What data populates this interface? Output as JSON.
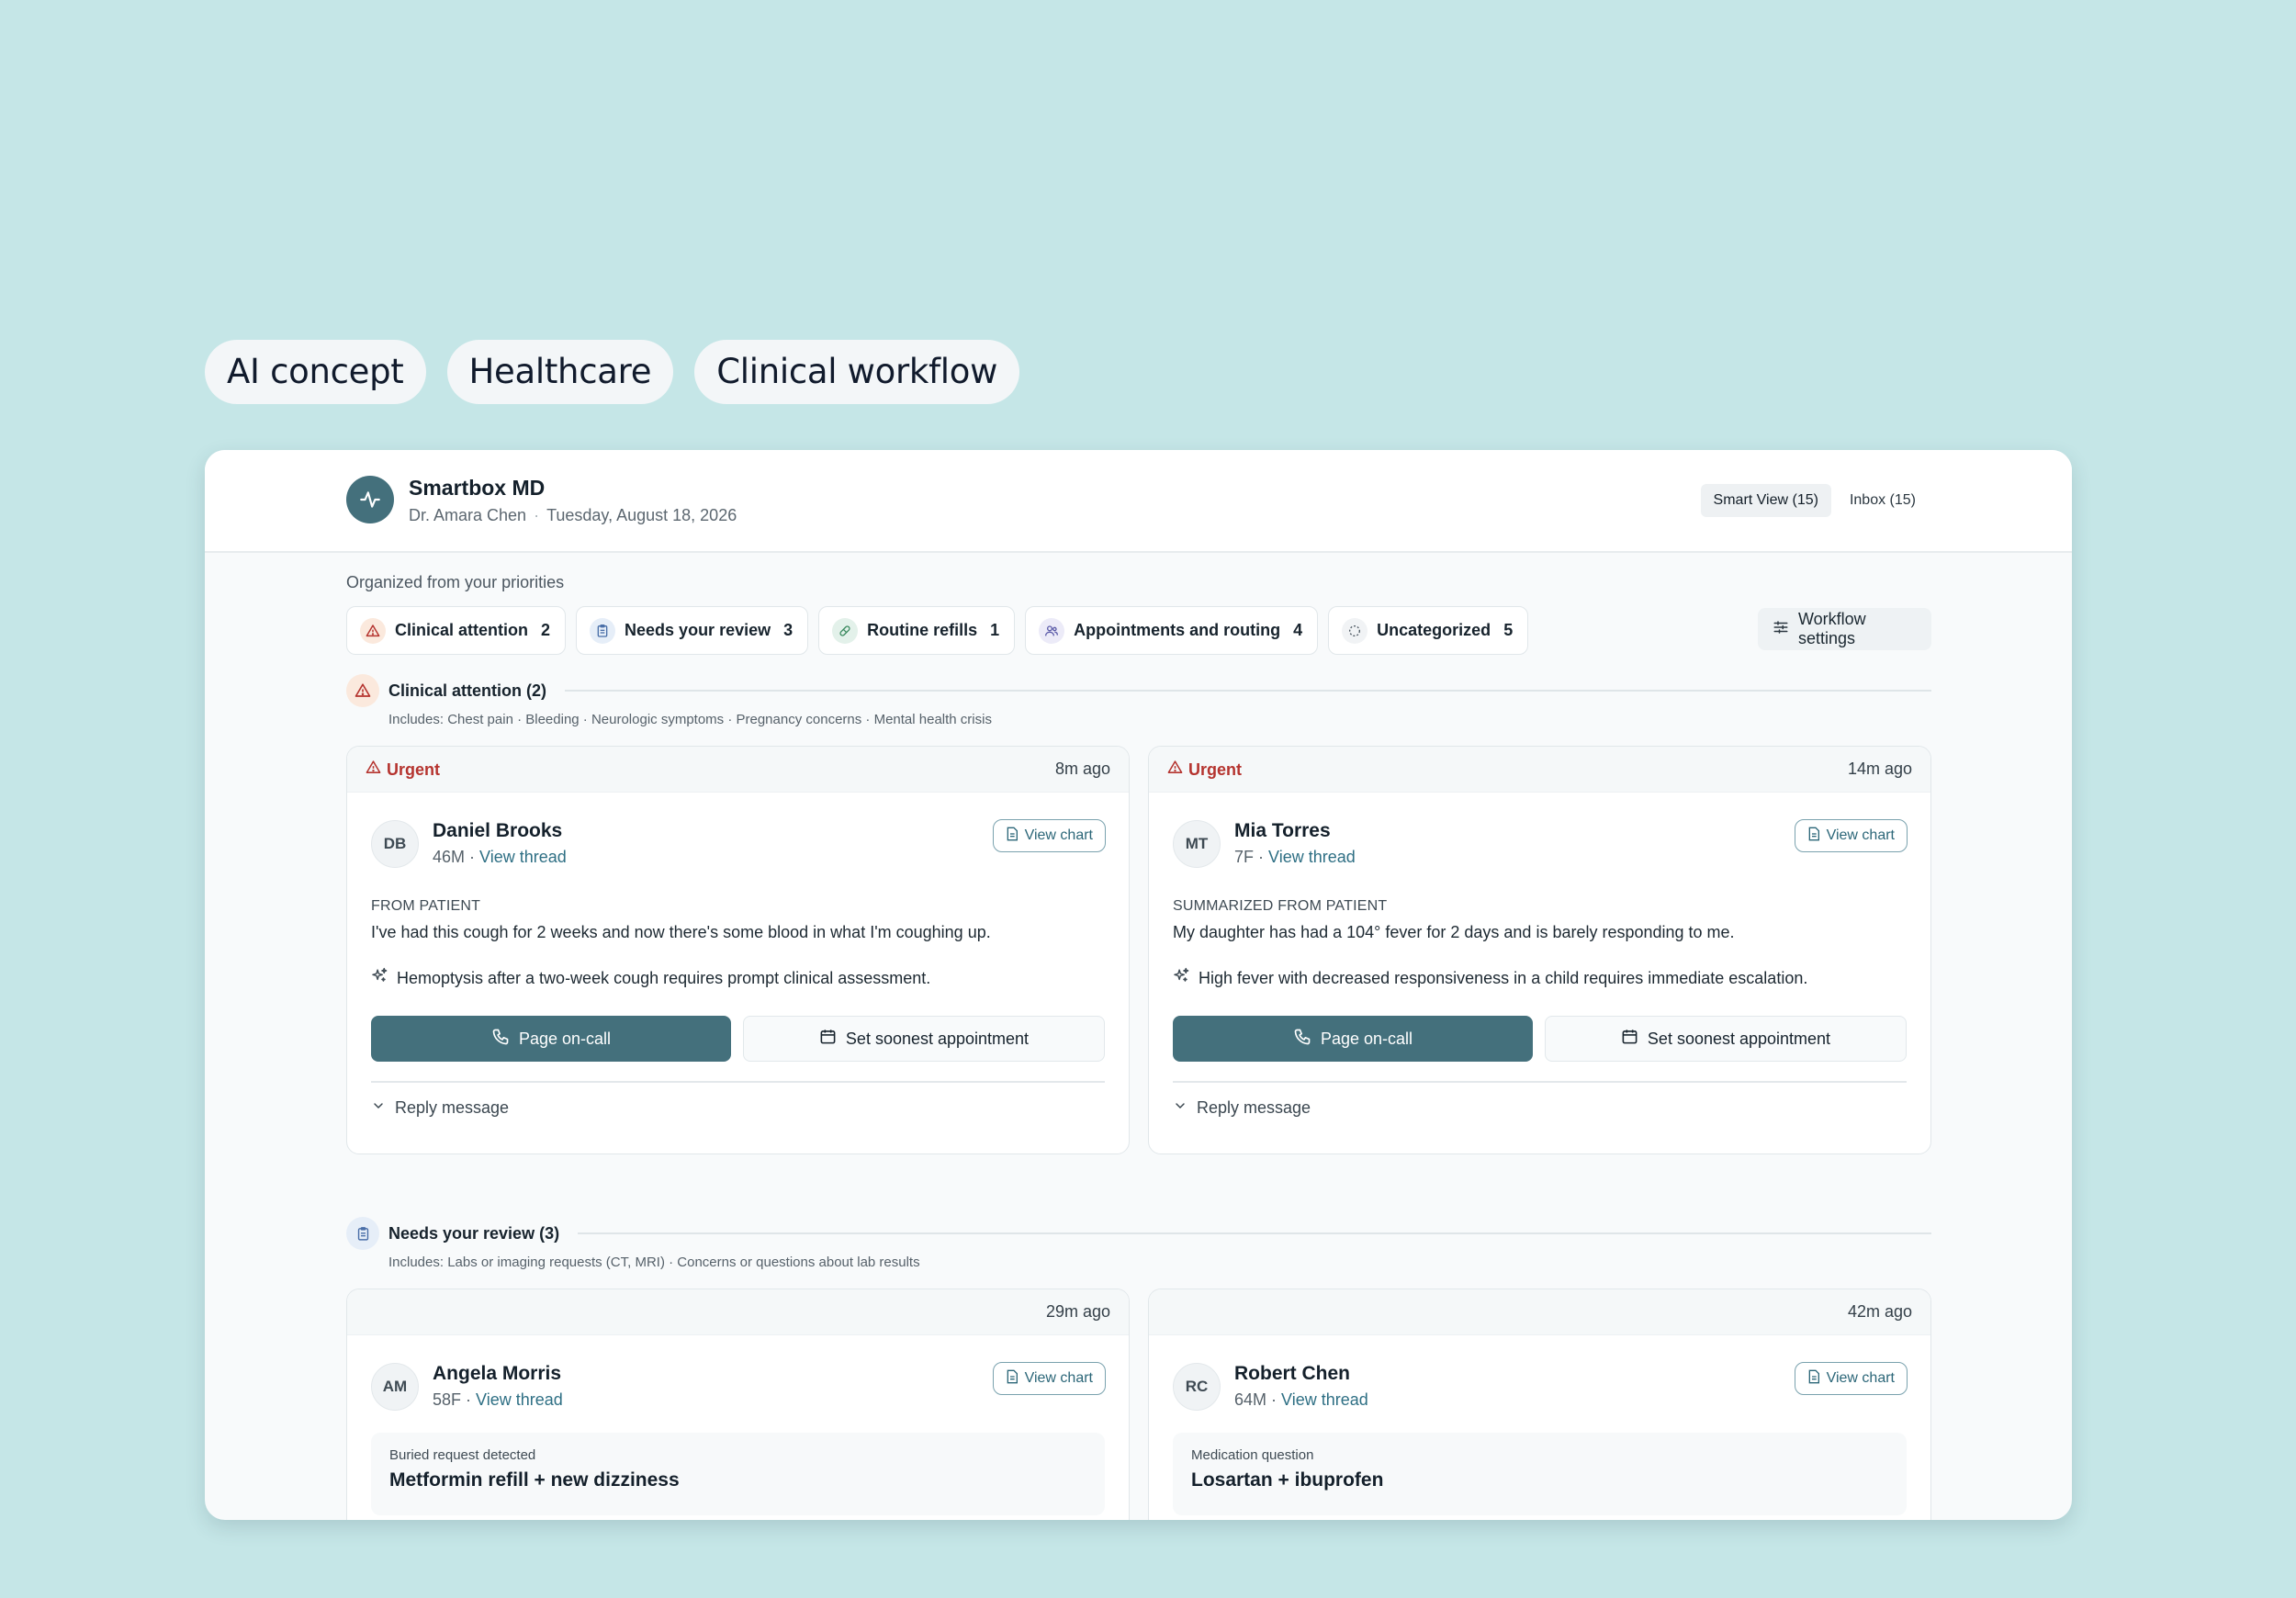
{
  "tags": [
    "AI concept",
    "Healthcare",
    "Clinical workflow"
  ],
  "app": {
    "title": "Smartbox MD",
    "doctor": "Dr. Amara Chen",
    "date": "Tuesday, August 18, 2026",
    "views": [
      {
        "label": "Smart View (15)",
        "active": true
      },
      {
        "label": "Inbox (15)",
        "active": false
      }
    ]
  },
  "organized_label": "Organized from your priorities",
  "filters": [
    {
      "label": "Clinical attention",
      "count": "2",
      "icon": "warning-icon",
      "color": "#fbe9dd"
    },
    {
      "label": "Needs your review",
      "count": "3",
      "icon": "clipboard-icon",
      "color": "#e6eef8"
    },
    {
      "label": "Routine refills",
      "count": "1",
      "icon": "pill-icon",
      "color": "#e3f1ea"
    },
    {
      "label": "Appointments and routing",
      "count": "4",
      "icon": "people-icon",
      "color": "#ecebf8"
    },
    {
      "label": "Uncategorized",
      "count": "5",
      "icon": "dashed-circle-icon",
      "color": "#f1f3f5"
    }
  ],
  "workflow_settings": "Workflow settings",
  "sections": {
    "clinical": {
      "title": "Clinical attention (2)",
      "includes": "Includes: Chest pain · Bleeding · Neurologic symptoms · Pregnancy concerns · Mental health crisis",
      "cards": [
        {
          "badge": "Urgent",
          "time": "8m ago",
          "initials": "DB",
          "name": "Daniel Brooks",
          "demo": "46M · ",
          "thread": "View thread",
          "chart": "View chart",
          "source": "FROM PATIENT",
          "message": "I've had this cough for 2 weeks and now there's some blood in what I'm coughing up.",
          "ai": "Hemoptysis after a two-week cough requires prompt clinical assessment.",
          "primary": "Page on-call",
          "secondary": "Set soonest appointment",
          "reply": "Reply message"
        },
        {
          "badge": "Urgent",
          "time": "14m ago",
          "initials": "MT",
          "name": "Mia Torres",
          "demo": "7F · ",
          "thread": "View thread",
          "chart": "View chart",
          "source": "SUMMARIZED FROM PATIENT",
          "message": "My daughter has had a 104° fever for 2 days and is barely responding to me.",
          "ai": "High fever with decreased responsiveness in a child requires immediate escalation.",
          "primary": "Page on-call",
          "secondary": "Set soonest appointment",
          "reply": "Reply message"
        }
      ]
    },
    "review": {
      "title": "Needs your review (3)",
      "includes": "Includes: Labs or imaging requests (CT, MRI) · Concerns or questions about lab results",
      "cards": [
        {
          "time": "29m ago",
          "initials": "AM",
          "name": "Angela Morris",
          "demo": "58F · ",
          "thread": "View thread",
          "chart": "View chart",
          "req_label": "Buried request detected",
          "req_title": "Metformin refill + new dizziness"
        },
        {
          "time": "42m ago",
          "initials": "RC",
          "name": "Robert Chen",
          "demo": "64M · ",
          "thread": "View thread",
          "chart": "View chart",
          "req_label": "Medication question",
          "req_title": "Losartan + ibuprofen"
        }
      ]
    }
  },
  "colors": {
    "background": "#c5e6e7",
    "accent": "#44707c",
    "urgent": "#b5342f",
    "link": "#2e6f84"
  }
}
